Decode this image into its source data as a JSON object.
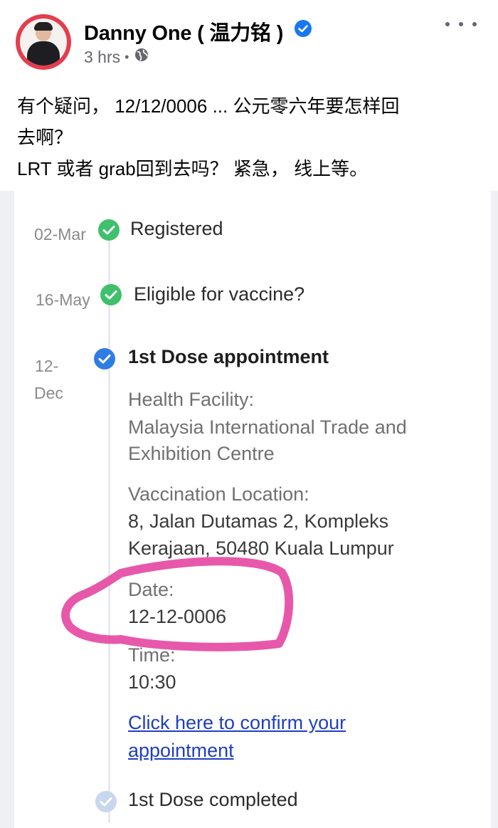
{
  "post": {
    "author": "Danny One ( 温力铭 )",
    "timestamp": "3 hrs",
    "separator": "•",
    "audience_icon": "globe-icon",
    "verified_icon": "verified-badge-icon",
    "more_icon": "more-options-icon",
    "text_lines": [
      "有个疑问， 12/12/0006 ... 公元零六年要怎样回",
      "去啊？",
      "LRT 或者 grab回到去吗？ 紧急， 线上等。"
    ]
  },
  "timeline": {
    "step1": {
      "date": "02-Mar",
      "title": "Registered",
      "status": "completed"
    },
    "step2": {
      "date": "16-May",
      "title": "Eligible for vaccine?",
      "status": "completed"
    },
    "step3": {
      "date_line1": "12-",
      "date_line2": "Dec",
      "title": "1st Dose appointment",
      "facility_label": "Health Facility:",
      "facility_line1": "Malaysia International Trade and",
      "facility_line2": "Exhibition Centre",
      "location_label": "Vaccination Location:",
      "location_line1": "8, Jalan Dutamas 2, Kompleks",
      "location_line2": "Kerajaan, 50480 Kuala Lumpur",
      "date_label": "Date:",
      "date_value": "12-12-0006",
      "time_label": "Time:",
      "time_value": "10:30",
      "confirm_link_line1": "Click here to confirm your",
      "confirm_link_line2": "appointment"
    },
    "step4": {
      "title": "1st Dose completed",
      "status": "pending"
    }
  },
  "colors": {
    "facebook_blue": "#1877f2",
    "check_green": "#3fc06c",
    "check_blue": "#2f7de1",
    "highlight_pink": "#e64fa6",
    "link_blue": "#1f3fbf"
  }
}
